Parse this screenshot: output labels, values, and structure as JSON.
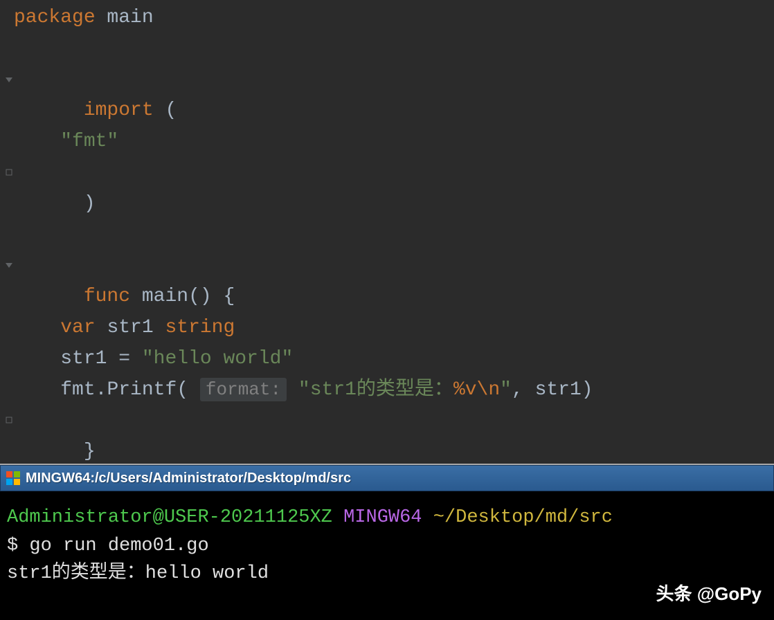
{
  "editor": {
    "lines": {
      "l1_kw": "package",
      "l1_name": " main",
      "l3_kw": "import",
      "l3_paren": " (",
      "l4_indent": "    ",
      "l4_str": "\"fmt\"",
      "l5_paren": ")",
      "l7_kw": "func",
      "l7_name": " main",
      "l7_sig": "() {",
      "l8_indent": "    ",
      "l8_var": "var",
      "l8_name": " str1 ",
      "l8_type": "string",
      "l9_indent": "    ",
      "l9_assign": "str1 = ",
      "l9_val": "\"hello world\"",
      "l10_indent": "    ",
      "l10_pkg": "fmt",
      "l10_dot": ".",
      "l10_fn": "Printf",
      "l10_open": "( ",
      "l10_hint": "format:",
      "l10_sp": " ",
      "l10_str1": "\"str1的类型是：",
      "l10_verb": "%v",
      "l10_esc": "\\n",
      "l10_str2": "\"",
      "l10_args": ", str1)",
      "l11_close": "}"
    }
  },
  "terminal": {
    "title": "MINGW64:/c/Users/Administrator/Desktop/md/src",
    "prompt_user": "Administrator@USER-20211125XZ",
    "prompt_mingw": " MINGW64 ",
    "prompt_path": "~/Desktop/md/src",
    "cmd_prefix": "$ ",
    "cmd": "go run demo01.go",
    "output": "str1的类型是：hello world"
  },
  "watermark": "头条 @GoPy"
}
